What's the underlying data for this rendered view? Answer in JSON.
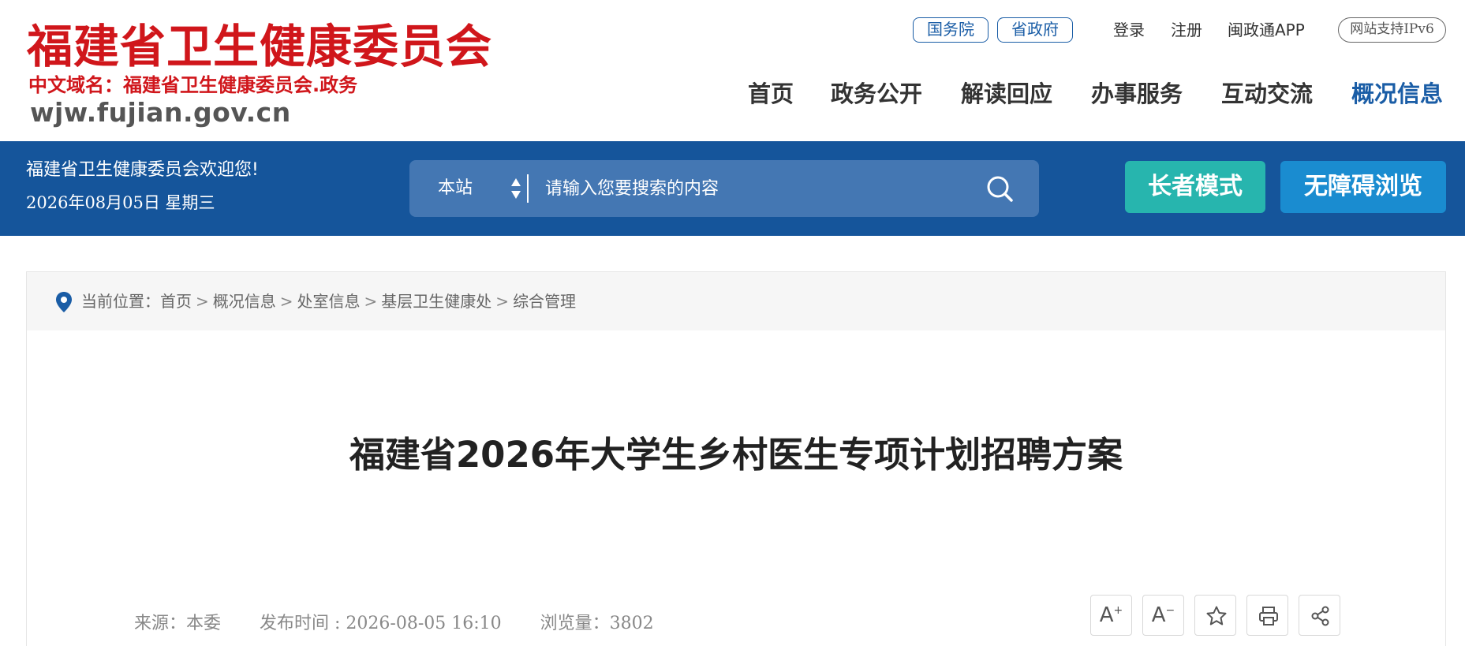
{
  "header": {
    "logo_title": "福建省卫生健康委员会",
    "logo_cn_domain": "中文域名：福建省卫生健康委员会.政务",
    "logo_domain": "wjw.fujian.gov.cn",
    "top_links": {
      "guowuyuan": "国务院",
      "shengzhengfu": "省政府",
      "login": "登录",
      "register": "注册",
      "app": "闽政通APP",
      "ipv6": "网站支持IPv6"
    },
    "nav": [
      "首页",
      "政务公开",
      "解读回应",
      "办事服务",
      "互动交流",
      "概况信息"
    ],
    "active_nav": "概况信息"
  },
  "band": {
    "welcome": "福建省卫生健康委员会欢迎您!",
    "date": "2026年08月05日 星期三",
    "search": {
      "scope": "本站",
      "placeholder": "请输入您要搜索的内容"
    },
    "elder_mode": "长者模式",
    "accessible": "无障碍浏览"
  },
  "breadcrumb": {
    "label": "当前位置：",
    "items": [
      "首页",
      "概况信息",
      "处室信息",
      "基层卫生健康处",
      "综合管理"
    ],
    "separator": ">"
  },
  "article": {
    "title": "福建省2026年大学生乡村医生专项计划招聘方案",
    "source": "来源：本委",
    "publish_time": "发布时间 : 2026-08-05 16:10",
    "views": "浏览量：3802"
  },
  "tools": {
    "font_increase": "A",
    "font_decrease": "A",
    "plus": "+",
    "minus": "−"
  },
  "colors": {
    "logo_red": "#d0161b",
    "brand_blue": "#15559b",
    "search_bg": "#4477b3",
    "elder_btn": "#27b5ae",
    "access_btn": "#1a8cd0"
  }
}
